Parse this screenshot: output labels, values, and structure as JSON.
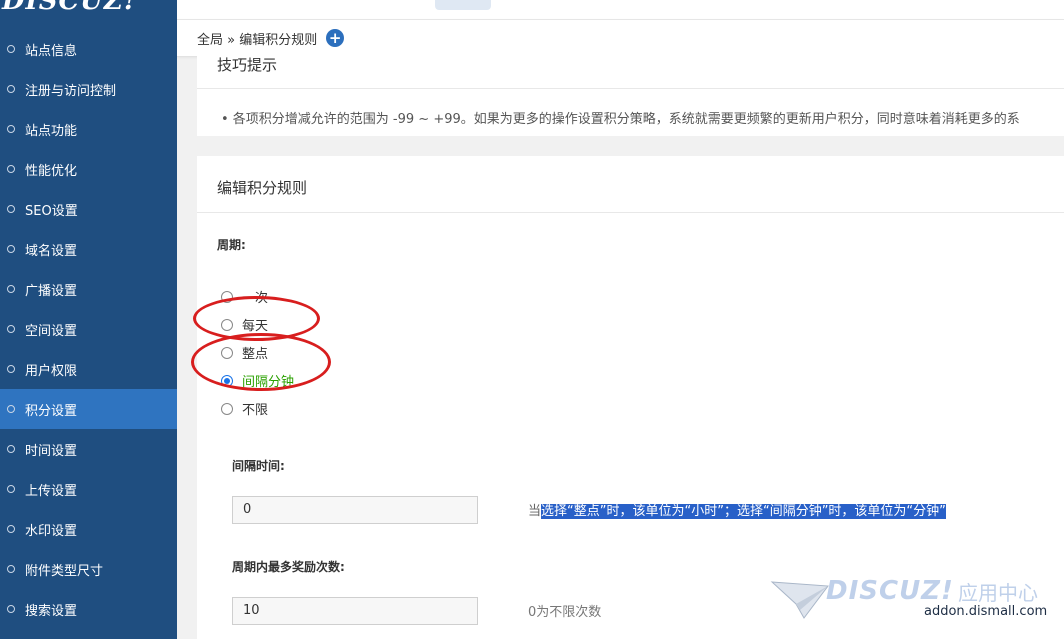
{
  "brand": {
    "logo_text": "DISCUZ!"
  },
  "sidebar": {
    "active_index": 9,
    "items": [
      {
        "label": "站点信息"
      },
      {
        "label": "注册与访问控制"
      },
      {
        "label": "站点功能"
      },
      {
        "label": "性能优化"
      },
      {
        "label": "SEO设置"
      },
      {
        "label": "域名设置"
      },
      {
        "label": "广播设置"
      },
      {
        "label": "空间设置"
      },
      {
        "label": "用户权限"
      },
      {
        "label": "积分设置"
      },
      {
        "label": "时间设置"
      },
      {
        "label": "上传设置"
      },
      {
        "label": "水印设置"
      },
      {
        "label": "附件类型尺寸"
      },
      {
        "label": "搜索设置"
      }
    ]
  },
  "breadcrumb": {
    "text": "全局 » 编辑积分规则",
    "add_icon": "plus-circle-icon"
  },
  "tips": {
    "title": "技巧提示",
    "text": "•  各项积分增减允许的范围为 -99 ~ +99。如果为更多的操作设置积分策略，系统就需要更频繁的更新用户积分，同时意味着消耗更多的系"
  },
  "form": {
    "title": "编辑积分规则",
    "cycle_label": "周期:",
    "cycle_options": [
      {
        "label": "一次",
        "selected": false
      },
      {
        "label": "每天",
        "selected": false
      },
      {
        "label": "整点",
        "selected": false
      },
      {
        "label": "间隔分钟",
        "selected": true
      },
      {
        "label": "不限",
        "selected": false
      }
    ],
    "interval_label": "间隔时间:",
    "interval_value": "0",
    "interval_hint_prefix": "当",
    "interval_hint_highlight": "选择“整点”时，该单位为“小时”；选择“间隔分钟”时，该单位为“分钟”",
    "max_label": "周期内最多奖励次数:",
    "max_value": "10",
    "max_hint": "0为不限次数"
  },
  "watermark": {
    "brand": "DISCUZ!",
    "cn": "应用中心",
    "url": "addon.dismall.com"
  },
  "colors": {
    "sidebar_bg": "#1f4e80",
    "sidebar_active": "#2f74c0",
    "annotation_red": "#d81e1e",
    "highlight_blue": "#2860c8"
  }
}
